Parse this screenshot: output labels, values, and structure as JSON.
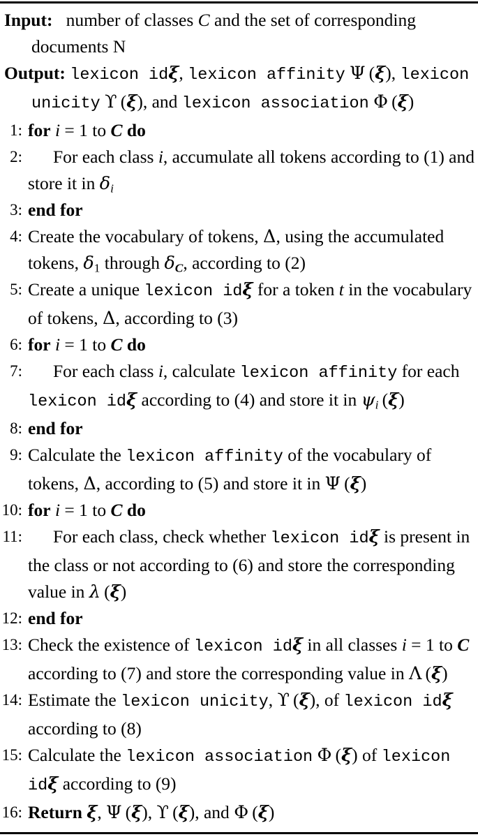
{
  "algorithm": {
    "io": [
      {
        "label": "Input:",
        "text": "number of classes C and the set of corresponding documents N"
      },
      {
        "label": "Output:",
        "text": "lexicon id ξ, lexicon affinity Ψ (ξ), lexicon unicity ϒ (ξ), and lexicon association Φ (ξ)"
      }
    ],
    "steps": [
      {
        "num": "1:",
        "indent": false,
        "text": "for i = 1 to C do"
      },
      {
        "num": "2:",
        "indent": true,
        "text": "For each class i, accumulate all tokens according to (1) and store it in δi"
      },
      {
        "num": "3:",
        "indent": false,
        "text": "end for"
      },
      {
        "num": "4:",
        "indent": false,
        "text": "Create the vocabulary of tokens, Δ, using the accumulated tokens, δ1 through δC, according to (2)"
      },
      {
        "num": "5:",
        "indent": false,
        "text": "Create a unique lexicon id ξ for a token t in the vocabulary of tokens, Δ, according to (3)"
      },
      {
        "num": "6:",
        "indent": false,
        "text": "for i = 1 to C do"
      },
      {
        "num": "7:",
        "indent": true,
        "text": "For each class i, calculate lexicon affinity for each lexicon id ξ according to (4) and store it in ψi (ξ)"
      },
      {
        "num": "8:",
        "indent": false,
        "text": "end for"
      },
      {
        "num": "9:",
        "indent": false,
        "text": "Calculate the lexicon affinity of the vocabulary of tokens, Δ, according to (5) and store it in Ψ (ξ)"
      },
      {
        "num": "10:",
        "indent": false,
        "text": "for i = 1 to C do"
      },
      {
        "num": "11:",
        "indent": true,
        "text": "For each class, check whether lexicon id ξ is present in the class or not according to (6) and store the corresponding value in λ (ξ)"
      },
      {
        "num": "12:",
        "indent": false,
        "text": "end for"
      },
      {
        "num": "13:",
        "indent": false,
        "text": "Check the existence of lexicon id ξ in all classes i = 1 to C according to (7) and store the corresponding value in Λ (ξ)"
      },
      {
        "num": "14:",
        "indent": false,
        "text": "Estimate the lexicon unicity, ϒ (ξ), of lexicon id ξ according to (8)"
      },
      {
        "num": "15:",
        "indent": false,
        "text": "Calculate the lexicon association Φ (ξ) of lexicon id ξ according to (9)"
      },
      {
        "num": "16:",
        "indent": false,
        "text": "Return ξ, Ψ (ξ), ϒ (ξ), and Φ (ξ)"
      }
    ],
    "keywords": {
      "for": "for",
      "do": "do",
      "end_for": "end for",
      "return": "Return"
    },
    "monospace_terms": {
      "lexicon": "lexicon",
      "id": "id",
      "affinity": "affinity",
      "unicity": "unicity",
      "association": "association"
    },
    "symbols": {
      "xi": "ξ",
      "Psi": "Ψ",
      "psi": "ψ",
      "Upsilon": "ϒ",
      "Phi": "Φ",
      "Delta": "Δ",
      "delta": "δ",
      "lambda": "λ",
      "Lambda": "Λ",
      "C": "C",
      "N": "N",
      "i": "i",
      "t": "t"
    },
    "equation_refs": [
      "(1)",
      "(2)",
      "(3)",
      "(4)",
      "(5)",
      "(6)",
      "(7)",
      "(8)",
      "(9)"
    ],
    "colors": {
      "text": "#000000",
      "background": "#ffffff",
      "rule": "#000000"
    }
  }
}
